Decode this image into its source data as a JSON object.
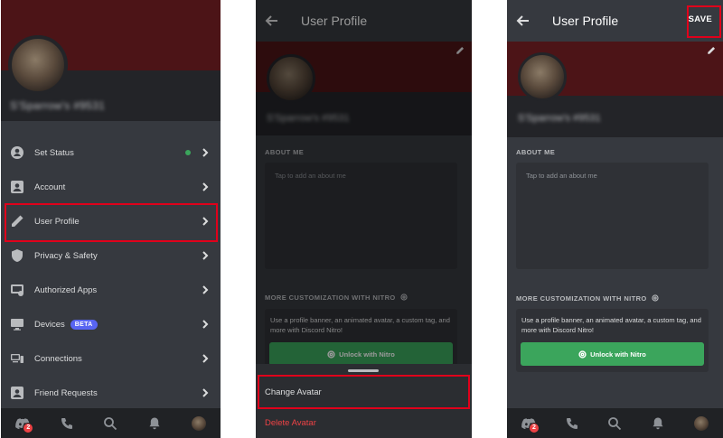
{
  "screen1": {
    "username": "S'Sparrow's #9531",
    "menu_items": [
      {
        "label": "Set Status",
        "icon": "status-icon",
        "badge": ""
      },
      {
        "label": "Account",
        "icon": "account-icon",
        "badge": ""
      },
      {
        "label": "User Profile",
        "icon": "pencil-icon",
        "badge": ""
      },
      {
        "label": "Privacy & Safety",
        "icon": "shield-icon",
        "badge": ""
      },
      {
        "label": "Authorized Apps",
        "icon": "apps-icon",
        "badge": ""
      },
      {
        "label": "Devices",
        "icon": "monitor-icon",
        "badge": "BETA"
      },
      {
        "label": "Connections",
        "icon": "connections-icon",
        "badge": ""
      },
      {
        "label": "Friend Requests",
        "icon": "friend-request-icon",
        "badge": ""
      }
    ],
    "nav_badge": "2"
  },
  "screen2": {
    "title": "User Profile",
    "username": "S'Sparrow's #9531",
    "about_label": "ABOUT ME",
    "about_placeholder": "Tap to add an about me",
    "nitro_label": "MORE CUSTOMIZATION WITH NITRO",
    "nitro_text": "Use a profile banner, an animated avatar, a custom tag, and more with Discord Nitro!",
    "nitro_button": "Unlock with Nitro",
    "sheet": {
      "change_avatar": "Change Avatar",
      "delete_avatar": "Delete Avatar"
    }
  },
  "screen3": {
    "title": "User Profile",
    "save_label": "SAVE",
    "username": "S'Sparrow's #9531",
    "about_label": "ABOUT ME",
    "about_placeholder": "Tap to add an about me",
    "nitro_label": "MORE CUSTOMIZATION WITH NITRO",
    "nitro_text": "Use a profile banner, an animated avatar, a custom tag, and more with Discord Nitro!",
    "nitro_button": "Unlock with Nitro",
    "nav_badge": "2"
  },
  "colors": {
    "highlight": "#e0001b",
    "banner": "#4c1417",
    "nitro_green": "#3ba55c",
    "danger": "#ed4245",
    "blurple": "#5865f2"
  }
}
